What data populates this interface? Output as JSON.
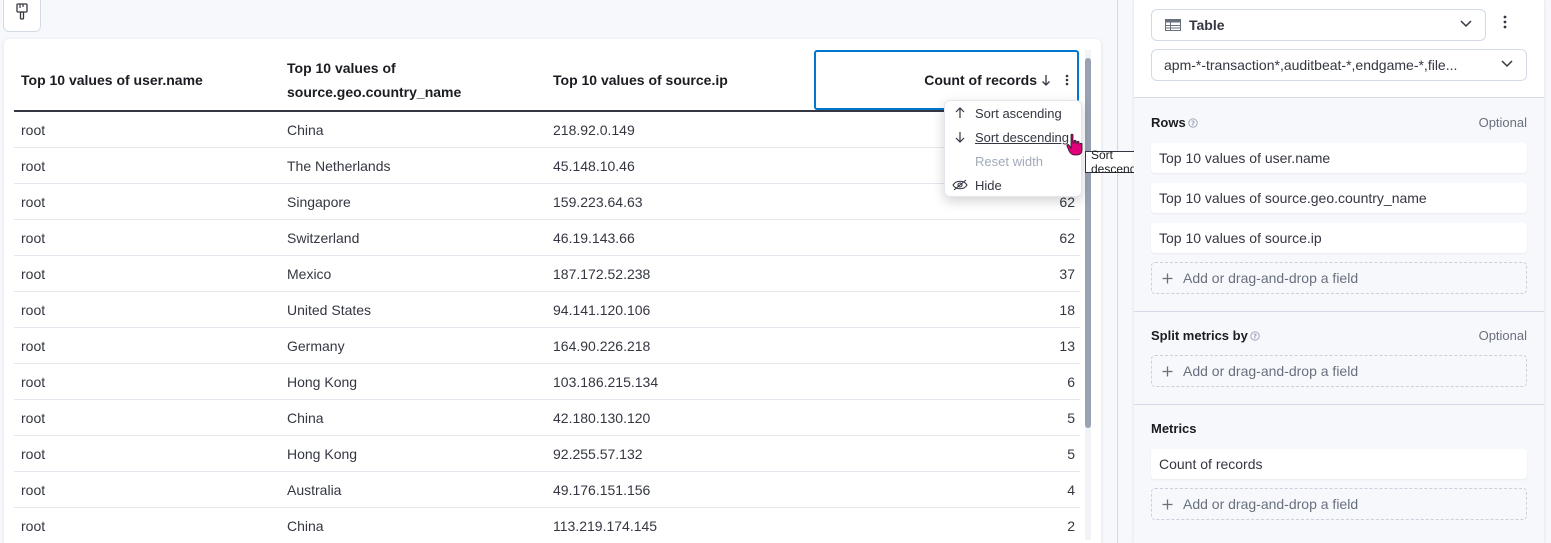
{
  "table": {
    "columns": [
      {
        "label": "Top 10 values of user.name"
      },
      {
        "label": "Top 10 values of source.geo.country_name"
      },
      {
        "label": "Top 10 values of source.ip"
      },
      {
        "label": "Count of records"
      }
    ],
    "rows": [
      {
        "user": "root",
        "country": "China",
        "ip": "218.92.0.149",
        "count": ""
      },
      {
        "user": "root",
        "country": "The Netherlands",
        "ip": "45.148.10.46",
        "count": ""
      },
      {
        "user": "root",
        "country": "Singapore",
        "ip": "159.223.64.63",
        "count": "62"
      },
      {
        "user": "root",
        "country": "Switzerland",
        "ip": "46.19.143.66",
        "count": "62"
      },
      {
        "user": "root",
        "country": "Mexico",
        "ip": "187.172.52.238",
        "count": "37"
      },
      {
        "user": "root",
        "country": "United States",
        "ip": "94.141.120.106",
        "count": "18"
      },
      {
        "user": "root",
        "country": "Germany",
        "ip": "164.90.226.218",
        "count": "13"
      },
      {
        "user": "root",
        "country": "Hong Kong",
        "ip": "103.186.215.134",
        "count": "6"
      },
      {
        "user": "root",
        "country": "China",
        "ip": "42.180.130.120",
        "count": "5"
      },
      {
        "user": "root",
        "country": "Hong Kong",
        "ip": "92.255.57.132",
        "count": "5"
      },
      {
        "user": "root",
        "country": "Australia",
        "ip": "49.176.151.156",
        "count": "4"
      },
      {
        "user": "root",
        "country": "China",
        "ip": "113.219.174.145",
        "count": "2"
      }
    ]
  },
  "column_menu": {
    "sort_ascending": "Sort ascending",
    "sort_descending": "Sort descending",
    "reset_width": "Reset width",
    "hide": "Hide",
    "tooltip": "Sort descending"
  },
  "config": {
    "chart_type": "Table",
    "data_view": "apm-*-transaction*,auditbeat-*,endgame-*,file...",
    "rows": {
      "title": "Rows",
      "optional": "Optional",
      "fields": [
        "Top 10 values of user.name",
        "Top 10 values of source.geo.country_name",
        "Top 10 values of source.ip"
      ],
      "add_label": "Add or drag-and-drop a field"
    },
    "split_metrics": {
      "title": "Split metrics by",
      "optional": "Optional",
      "add_label": "Add or drag-and-drop a field"
    },
    "metrics": {
      "title": "Metrics",
      "fields": [
        "Count of records"
      ],
      "add_label": "Add or drag-and-drop a field"
    }
  },
  "colors": {
    "accent": "#0077cc",
    "text": "#343741",
    "border": "#d3dae6",
    "cursor": "#e0007a"
  }
}
